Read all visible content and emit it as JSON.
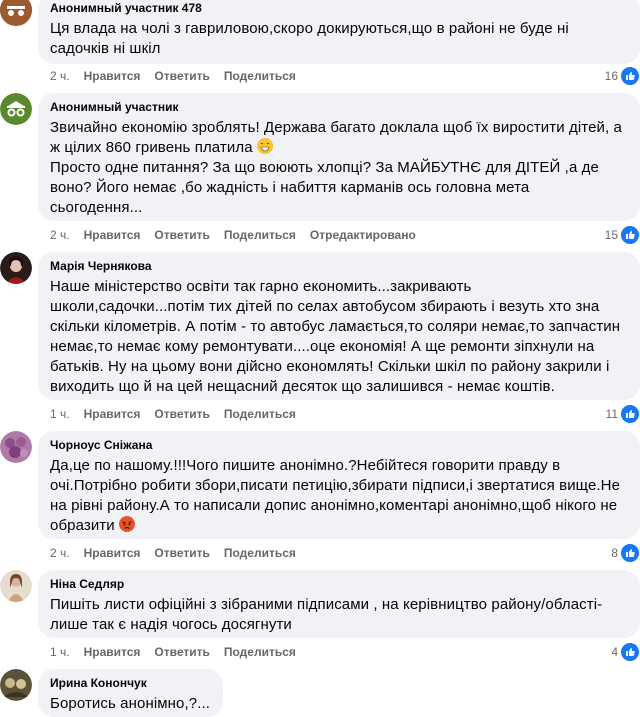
{
  "comments": [
    {
      "author": "Анонимный участник 478",
      "lines": [
        "Ця влада на чолі з гавриловою,скоро докируються,що в районі не буде ні",
        "садочків ні шкіл"
      ],
      "time": "2 ч.",
      "like": "Нравится",
      "reply": "Ответить",
      "share": "Поделиться",
      "count": "16"
    },
    {
      "author": "Анонимный участник",
      "lines": [
        "Звичайно економію зроблять! Держава багато доклала щоб їх виростити дітей, а",
        "ж цілих 860 гривень платила",
        "Просто одне питання? За що воюють хлопці? За МАЙБУТНЄ для ДІТЕЙ ,а де",
        "воно? Його немає ,бо жадність і набиття карманів ось головна мета",
        "сьогодення..."
      ],
      "time": "2 ч.",
      "like": "Нравится",
      "reply": "Ответить",
      "share": "Поделиться",
      "edited": "Отредактировано",
      "count": "15"
    },
    {
      "author": "Марія Чернякова",
      "lines": [
        "Наше міністерство освіти так гарно економить...закривають",
        "школи,садочки...потім тих дітей по селах автобусом збирають і везуть хто зна",
        "скільки кілометрів. А потім - то автобус ламається,то соляри немає,то запчастин",
        "немає,то немає кому ремонтувати....оце економія! А ще ремонти зіпхнули на",
        "батьків. Ну на цьому вони дійсно економлять! Скільки шкіл по району закрили і",
        "виходить що й на цей нещасний десяток що залишився - немає коштів."
      ],
      "time": "1 ч.",
      "like": "Нравится",
      "reply": "Ответить",
      "share": "Поделиться",
      "count": "11"
    },
    {
      "author": "Чорноус Сніжана",
      "lines": [
        "Да,це по нашому.!!!Чого пишите анонімно.?Небійтеся говорити правду в",
        "очі.Потрібно робити збори,писати петицію,збирати підписи,і звертатися вище.Не",
        "на рівні району.А то написали допис анонімно,коментарі анонімно,щоб нікого не",
        "образити"
      ],
      "time": "2 ч.",
      "like": "Нравится",
      "reply": "Ответить",
      "share": "Поделиться",
      "count": "8"
    },
    {
      "author": "Ніна Седляр",
      "lines": [
        "Пишіть листи офіційні з зібраними підписами , на керівництво району/області-",
        "лише так є надія чогось досягнути"
      ],
      "time": "1 ч.",
      "like": "Нравится",
      "reply": "Ответить",
      "share": "Поделиться",
      "count": "4"
    },
    {
      "author": "Ирина Конончук",
      "lines": [
        "Боротись анонімно,?..."
      ]
    }
  ],
  "colors": {
    "accent": "#1877f2",
    "bubble": "#f0f2f5",
    "meta": "#65676b"
  },
  "icons": [
    "anonymous-icon",
    "like-icon",
    "grin-emoji-icon",
    "angry-emoji-icon"
  ]
}
